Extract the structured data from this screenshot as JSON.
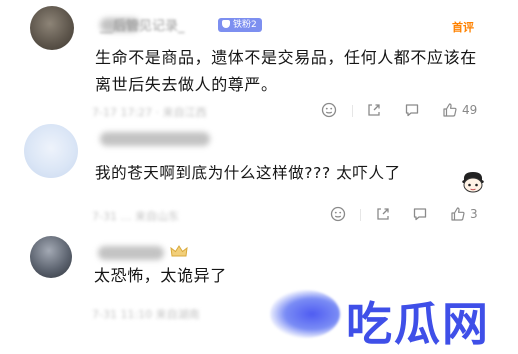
{
  "comments": [
    {
      "username": "__后管见记录_",
      "badge": "铁粉2",
      "first_tag": "首评",
      "text": "生命不是商品，遗体不是交易品，任何人都不应该在离世后失去做人的尊严。",
      "meta": "7-17 17:27 · 来自江西",
      "likes": "49"
    },
    {
      "username": "",
      "text": "我的苍天啊到底为什么这样做??? 太吓人了",
      "meta": "7-31 … 来自山东",
      "likes": "3"
    },
    {
      "username": "",
      "text": "太恐怖，太诡异了",
      "meta": "7-31 11:10 来自湖南"
    }
  ],
  "watermark": "吃瓜网",
  "icons": [
    "emoji-reaction-icon",
    "share-icon",
    "comment-icon",
    "like-icon"
  ],
  "colors": {
    "first_tag": "#ff8200",
    "badge": "#7d8ff0",
    "watermark": "#3f4fe8"
  }
}
